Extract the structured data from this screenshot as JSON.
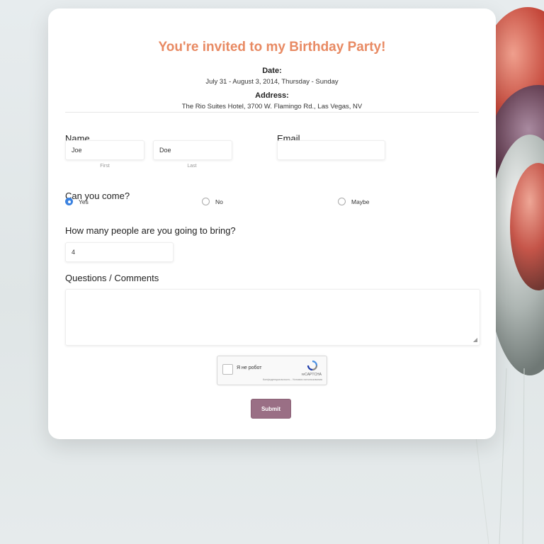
{
  "page": {
    "title": "You're invited to my Birthday Party!",
    "date_label": "Date:",
    "date_value": "July 31 - August 3, 2014, Thursday - Sunday",
    "address_label": "Address:",
    "address_value": "The Rio Suites Hotel, 3700 W. Flamingo Rd., Las Vegas, NV"
  },
  "form": {
    "name": {
      "label": "Name",
      "first_value": "Joe",
      "first_sublabel": "First",
      "last_value": "Doe",
      "last_sublabel": "Last"
    },
    "email": {
      "label": "Email",
      "value": ""
    },
    "attendance": {
      "label": "Can you come?",
      "options": [
        "Yes",
        "No",
        "Maybe"
      ],
      "selected": "Yes"
    },
    "guests": {
      "label": "How many people are you going to bring?",
      "value": "4"
    },
    "comments": {
      "label": "Questions / Comments",
      "value": ""
    },
    "captcha": {
      "checkbox_text": "Я не робот",
      "brand": "reCAPTCHA",
      "links": "Конфиденциальность - Условия использования",
      "icon": "recaptcha-icon"
    },
    "submit_label": "Submit"
  },
  "colors": {
    "title": "#e88a63",
    "accent_radio": "#3b82e0",
    "submit": "#9a6f85"
  }
}
